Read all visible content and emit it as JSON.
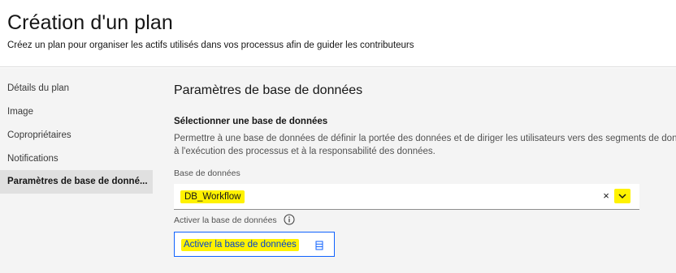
{
  "header": {
    "title": "Création d'un plan",
    "subtitle": "Créez un plan pour organiser les actifs utilisés dans vos processus afin de guider les contributeurs"
  },
  "sidebar": {
    "items": [
      {
        "label": "Détails du plan",
        "active": false
      },
      {
        "label": "Image",
        "active": false
      },
      {
        "label": "Copropriétaires",
        "active": false
      },
      {
        "label": "Notifications",
        "active": false
      },
      {
        "label": "Paramètres de base de donné...",
        "active": true
      }
    ]
  },
  "main": {
    "title": "Paramètres de base de données",
    "select_heading": "Sélectionner une base de données",
    "description_line1": "Permettre à une base de données de définir la portée des données et de diriger les utilisateurs vers des segments de don",
    "description_line2": "à l'exécution des processus et à la responsabilité des données.",
    "database_field": {
      "label": "Base de données",
      "value": "DB_Workflow",
      "clear_glyph": "×"
    },
    "activate": {
      "label": "Activer la base de données",
      "button_label": "Activer la base de données"
    }
  },
  "colors": {
    "highlight": "#fff200",
    "accent_blue": "#0f62fe",
    "link_blue": "#0043ce",
    "panel_bg": "#f4f4f4",
    "active_nav_bg": "#e0e0e0"
  },
  "icons": [
    "close-icon",
    "chevron-down-icon",
    "info-icon",
    "database-icon"
  ]
}
